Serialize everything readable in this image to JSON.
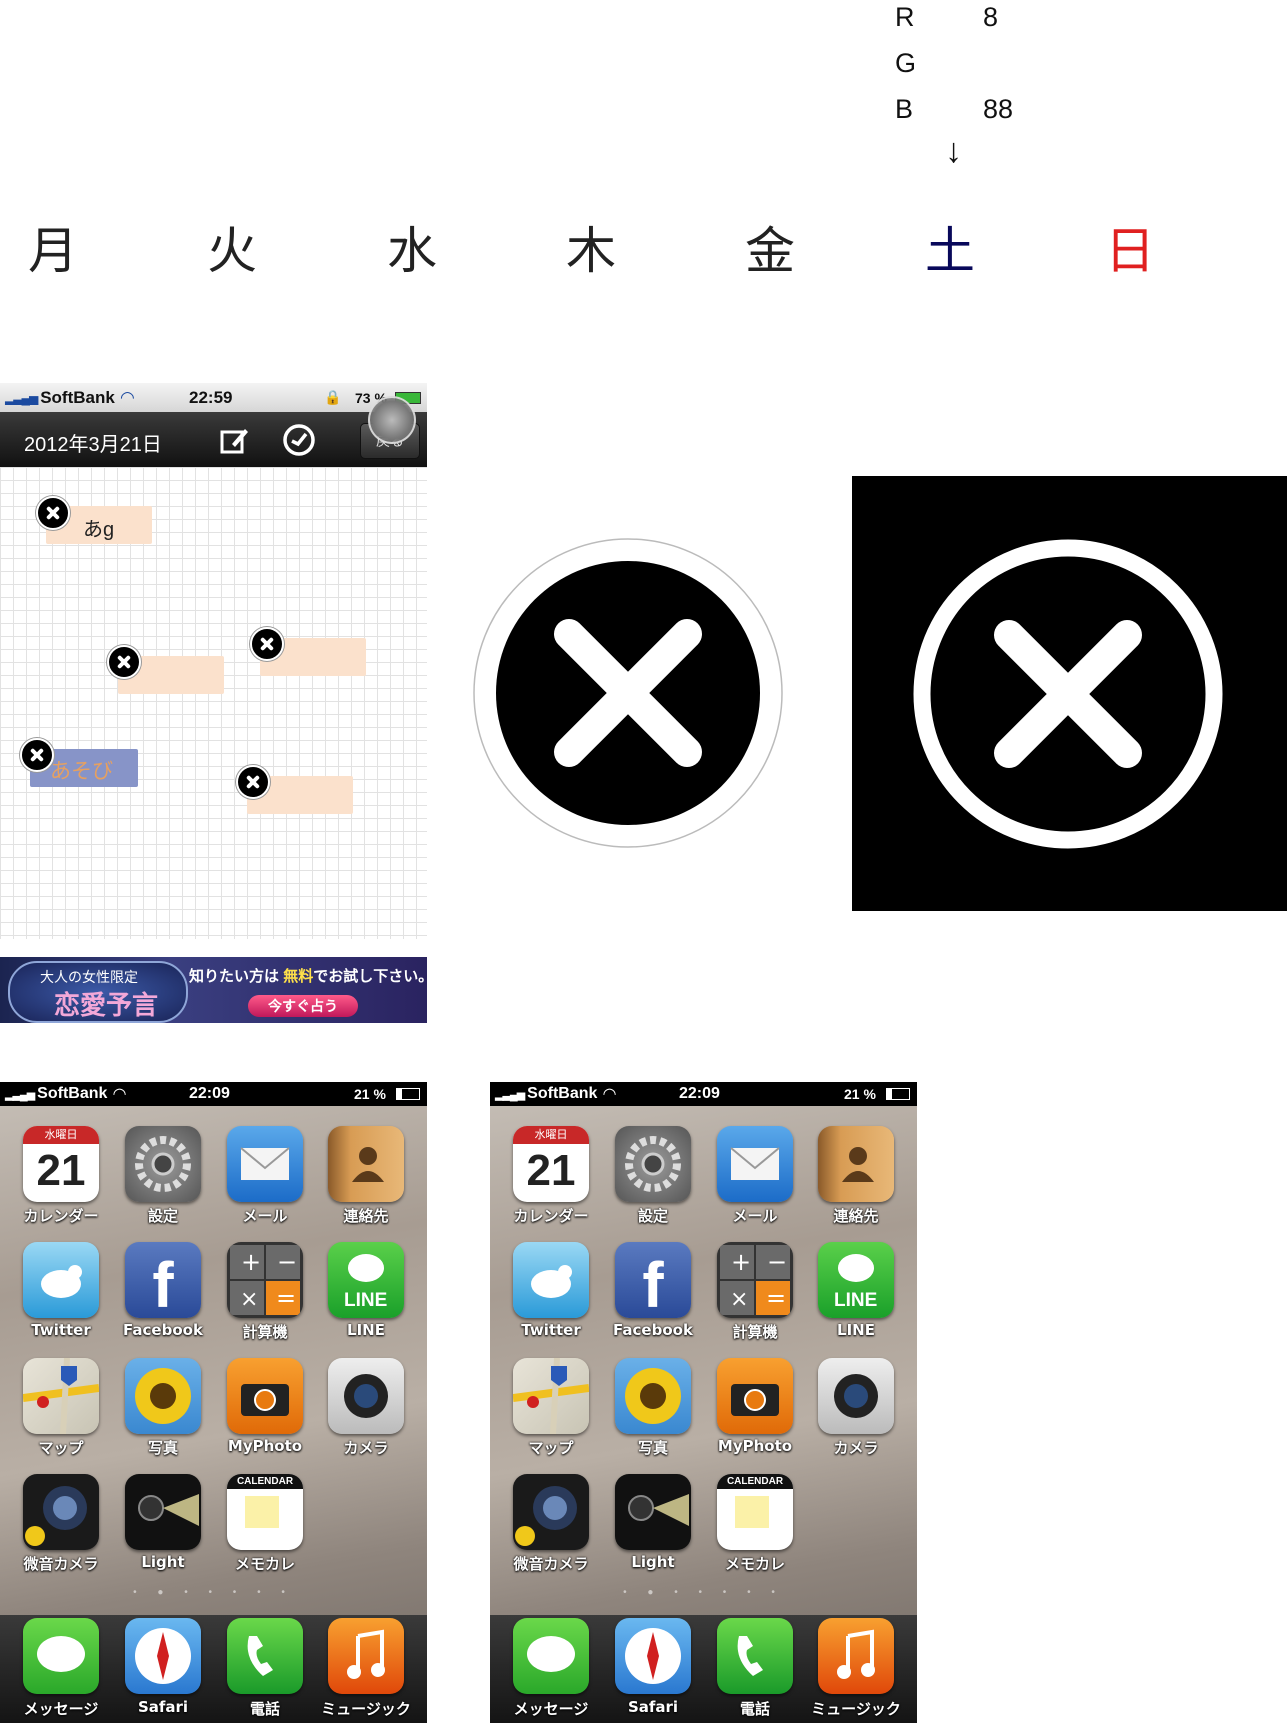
{
  "color_note": {
    "r_label": "R",
    "r_value": "8",
    "g_label": "G",
    "g_value": "",
    "b_label": "B",
    "b_value": "88",
    "arrow": "↓"
  },
  "weekdays": [
    {
      "label": "月",
      "color": "#222222"
    },
    {
      "label": "火",
      "color": "#222222"
    },
    {
      "label": "水",
      "color": "#222222"
    },
    {
      "label": "木",
      "color": "#222222"
    },
    {
      "label": "金",
      "color": "#222222"
    },
    {
      "label": "土",
      "color": "#08085a"
    },
    {
      "label": "日",
      "color": "#e02020"
    }
  ],
  "memo_screen": {
    "status": {
      "carrier": "SoftBank",
      "time": "22:59",
      "battery": "73 %"
    },
    "nav": {
      "date": "2012年3月21日",
      "back_label": "戻る"
    },
    "notes": [
      {
        "text": "あg"
      },
      {
        "text": ""
      },
      {
        "text": ""
      },
      {
        "text": "あそび"
      },
      {
        "text": ""
      }
    ],
    "ad": {
      "badge": "大人の女性限定",
      "title": "恋愛予言",
      "tagline_pre": "知りたい方は",
      "tagline_free": "無料",
      "tagline_post": "でお試し下さい。",
      "cta": "今すぐ占う"
    }
  },
  "home_screens": [
    {
      "status": {
        "carrier": "SoftBank",
        "time": "22:09",
        "battery": "21 %"
      },
      "calendar_icon": {
        "weekday": "水曜日",
        "day": "21"
      },
      "memo_icon_header": "CALENDAR",
      "apps": [
        "カレンダー",
        "設定",
        "メール",
        "連絡先",
        "Twitter",
        "Facebook",
        "計算機",
        "LINE",
        "マップ",
        "写真",
        "MyPhoto",
        "カメラ",
        "微音カメラ",
        "Light",
        "メモカレ"
      ],
      "dock": [
        "メッセージ",
        "Safari",
        "電話",
        "ミュージック"
      ],
      "page_dots": "• ● • • • • •"
    },
    {
      "status": {
        "carrier": "SoftBank",
        "time": "22:09",
        "battery": "21 %"
      },
      "calendar_icon": {
        "weekday": "水曜日",
        "day": "21"
      },
      "memo_icon_header": "CALENDAR",
      "apps": [
        "カレンダー",
        "設定",
        "メール",
        "連絡先",
        "Twitter",
        "Facebook",
        "計算機",
        "LINE",
        "マップ",
        "写真",
        "MyPhoto",
        "カメラ",
        "微音カメラ",
        "Light",
        "メモカレ"
      ],
      "dock": [
        "メッセージ",
        "Safari",
        "電話",
        "ミュージック"
      ],
      "page_dots": "• ● • • • • •"
    }
  ],
  "icon_names": [
    "close-icon-circle",
    "close-icon-square"
  ]
}
